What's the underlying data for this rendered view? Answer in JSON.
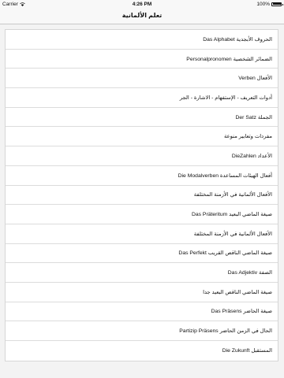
{
  "status_bar": {
    "carrier": "Carrier",
    "time": "4:26 PM",
    "battery": "100%",
    "battery_level": 1.0
  },
  "navbar": {
    "title": "تعلم الألمانية"
  },
  "lessons": [
    "الحروف الأبجدية Das Alphabet",
    "الضمائر الشخصية Personalpronomen",
    "الأفعال Verben",
    "أدوات التعريف - الإستفهام - الاشارة - الجر",
    "الجملة Der Satz",
    "مفردات وتعابير منوعة",
    "الأعداد DieZahlen",
    "أفعال الهيئات المساعدة Die Modalverben",
    "الأفعال الألمانية في الأزمنة المختلفة",
    "صيغة الماضي البعيد Das Präteritum",
    "الأفعال الألمانية في الأزمنة المختلفة",
    "صيغة الماضي الناقص القريب Das Perfekt",
    "الصفة Das Adjektiv",
    "صيغة الماضي الناقص البعيد جدا",
    "صيغة الحاضر Das Präsens",
    "الحال في الزمن الحاضر Partizip Präsens",
    "المستقبل Die Zukunft"
  ]
}
